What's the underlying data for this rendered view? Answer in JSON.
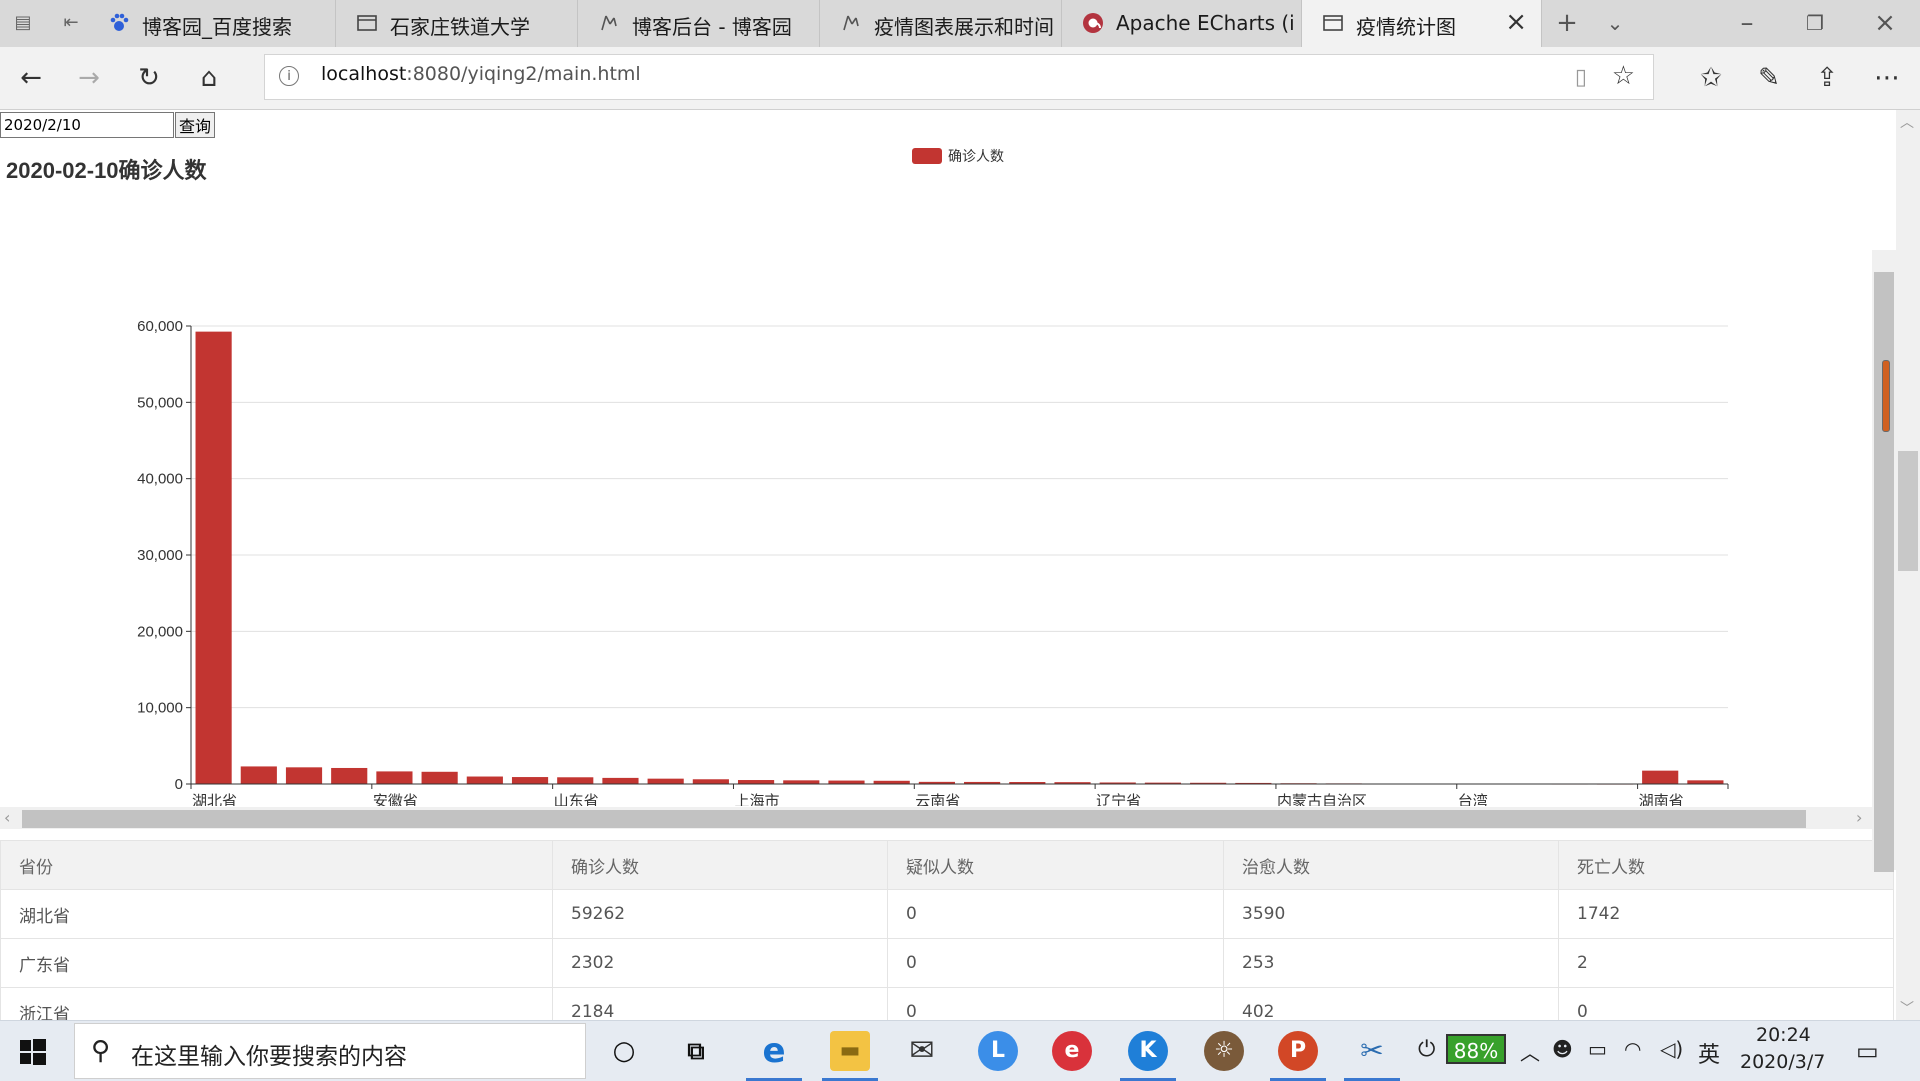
{
  "browser": {
    "tabs": [
      {
        "label": "博客园_百度搜索",
        "icon": "paw-icon"
      },
      {
        "label": "石家庄铁道大学",
        "icon": "page-icon"
      },
      {
        "label": "博客后台 - 博客园",
        "icon": "spinner-icon"
      },
      {
        "label": "疫情图表展示和时间",
        "icon": "spinner-icon"
      },
      {
        "label": "Apache ECharts (incu",
        "icon": "echarts-icon"
      },
      {
        "label": "疫情统计图",
        "icon": "page-icon",
        "active": true
      }
    ],
    "url_host": "localhost",
    "url_path": ":8080/yiqing2/main.html"
  },
  "page": {
    "date_value": "2020/2/10",
    "query_label": "查询"
  },
  "chart_data": {
    "type": "bar",
    "title": "2020-02-10确诊人数",
    "legend": [
      "确诊人数"
    ],
    "legend_position": "top-center",
    "color": "#c23531",
    "ylim": [
      0,
      60000
    ],
    "yticks": [
      "0",
      "10,000",
      "20,000",
      "30,000",
      "40,000",
      "50,000",
      "60,000"
    ],
    "xticks": [
      {
        "index": 0,
        "label": "湖北省"
      },
      {
        "index": 4,
        "label": "安徽省"
      },
      {
        "index": 8,
        "label": "山东省"
      },
      {
        "index": 12,
        "label": "上海市"
      },
      {
        "index": 16,
        "label": "云南省"
      },
      {
        "index": 20,
        "label": "辽宁省"
      },
      {
        "index": 24,
        "label": "内蒙古自治区"
      },
      {
        "index": 28,
        "label": "台湾"
      },
      {
        "index": 32,
        "label": "湖南省"
      }
    ],
    "values": [
      59262,
      2302,
      2184,
      2100,
      1650,
      1600,
      980,
      910,
      880,
      800,
      700,
      620,
      520,
      480,
      450,
      420,
      280,
      270,
      260,
      240,
      200,
      180,
      160,
      140,
      100,
      80,
      60,
      40,
      25,
      18,
      10,
      5,
      1750,
      480
    ],
    "grid": true
  },
  "table": {
    "headers": [
      "省份",
      "确诊人数",
      "疑似人数",
      "治愈人数",
      "死亡人数"
    ],
    "rows": [
      [
        "湖北省",
        "59262",
        "0",
        "3590",
        "1742"
      ],
      [
        "广东省",
        "2302",
        "0",
        "253",
        "2"
      ],
      [
        "浙江省",
        "2184",
        "0",
        "402",
        "0"
      ]
    ]
  },
  "taskbar": {
    "search_placeholder": "在这里输入你要搜索的内容",
    "battery": "88%",
    "ime": "英",
    "time": "20:24",
    "date": "2020/3/7"
  }
}
